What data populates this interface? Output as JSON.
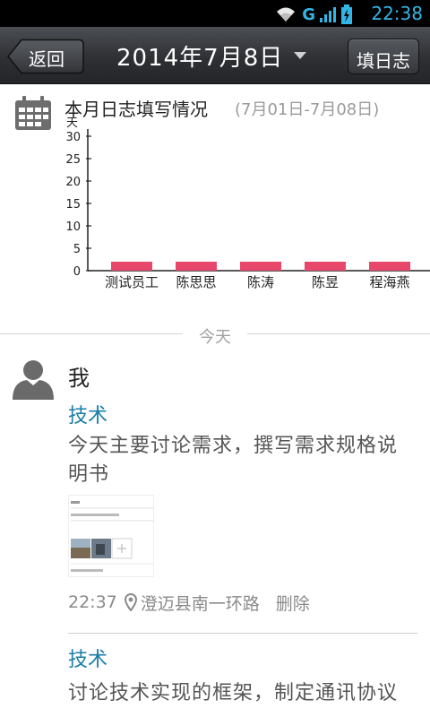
{
  "status_bar": {
    "network": "G",
    "time": "22:38"
  },
  "titlebar": {
    "back_label": "返回",
    "date": "2014年7月8日",
    "write_label": "填日志"
  },
  "summary": {
    "title": "本月日志填写情况",
    "range": "(7月01日-7月08日)"
  },
  "chart_data": {
    "type": "bar",
    "ylabel": "天",
    "yticks": [
      0,
      5,
      10,
      15,
      20,
      25,
      30
    ],
    "ylim": [
      0,
      30
    ],
    "categories": [
      "测试员工",
      "陈思思",
      "陈涛",
      "陈昱",
      "程海燕"
    ],
    "values": [
      2,
      2,
      2,
      2,
      2
    ],
    "bar_color": "#e8476c",
    "grid": false
  },
  "divider": {
    "label": "今天"
  },
  "entry": {
    "author": "我",
    "items": [
      {
        "tag": "技术",
        "text": "今天主要讨论需求，撰写需求规格说明书"
      },
      {
        "tag": "技术",
        "text": "讨论技术实现的框架，制定通讯协议"
      }
    ],
    "time": "22:37",
    "location": "澄迈县南一环路",
    "delete_label": "删除"
  },
  "colors": {
    "accent": "#33b5e5",
    "link": "#1a7ea8",
    "titlebar": "#2e3034"
  }
}
